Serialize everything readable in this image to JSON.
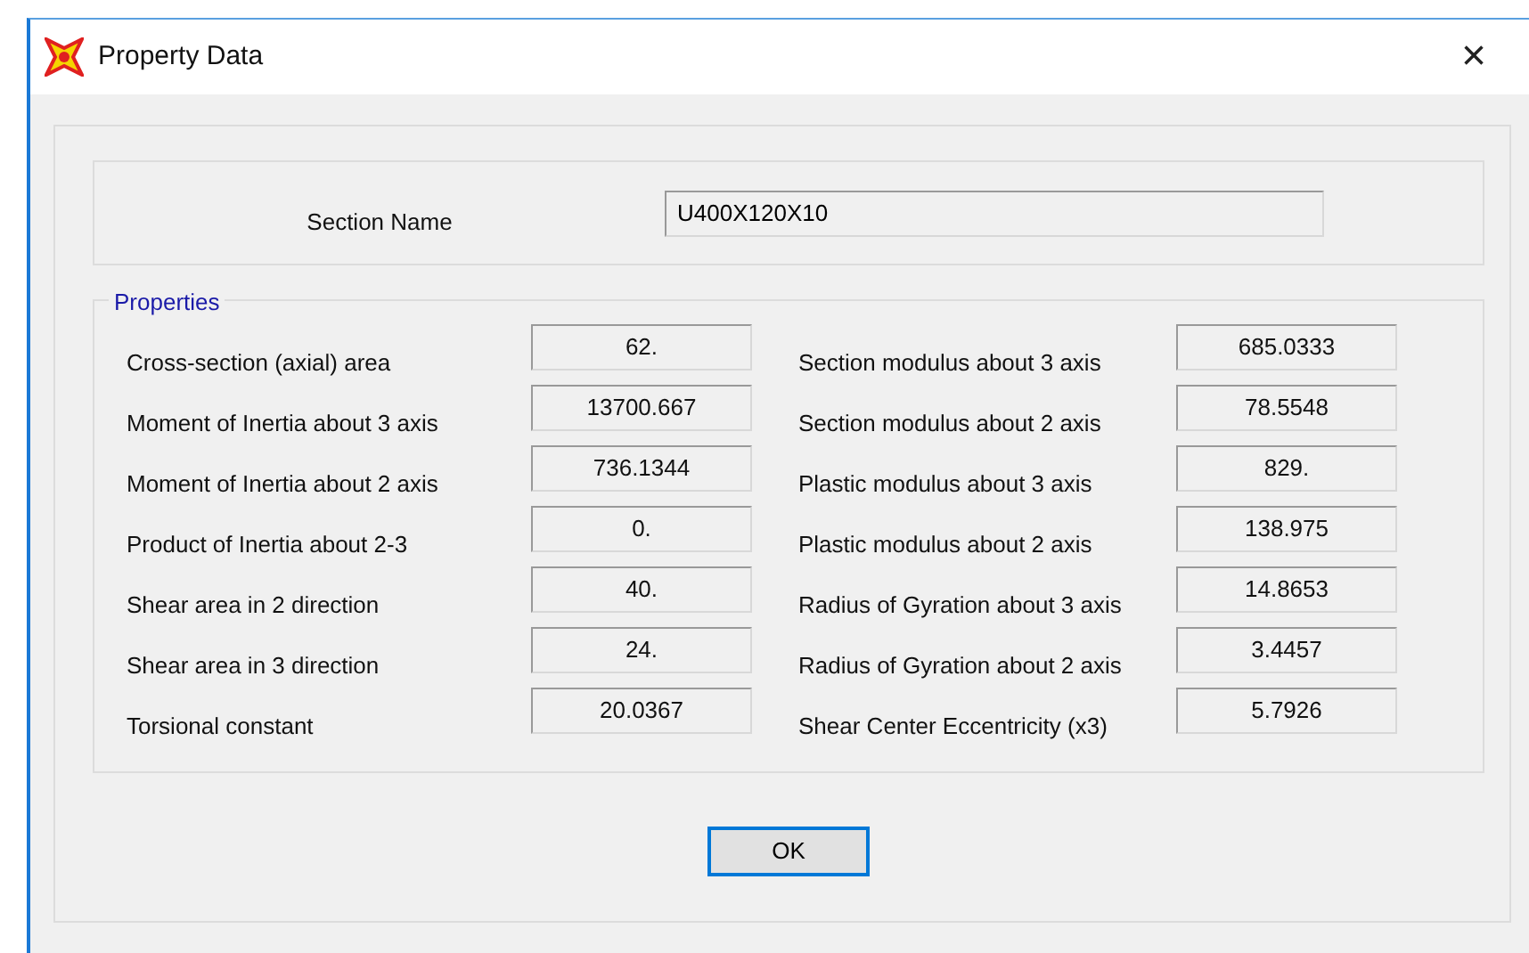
{
  "window": {
    "title": "Property Data",
    "close": "×"
  },
  "section_name": {
    "label": "Section Name",
    "value": "U400X120X10"
  },
  "properties": {
    "title": "Properties",
    "left": [
      {
        "label": "Cross-section (axial) area",
        "value": "62."
      },
      {
        "label": "Moment of Inertia about 3 axis",
        "value": "13700.667"
      },
      {
        "label": "Moment of Inertia about 2 axis",
        "value": "736.1344"
      },
      {
        "label": "Product of Inertia about 2-3",
        "value": "0."
      },
      {
        "label": "Shear area in 2 direction",
        "value": "40."
      },
      {
        "label": "Shear area in 3 direction",
        "value": "24."
      },
      {
        "label": "Torsional constant",
        "value": "20.0367"
      }
    ],
    "right": [
      {
        "label": "Section modulus about 3 axis",
        "value": "685.0333"
      },
      {
        "label": "Section modulus about 2 axis",
        "value": "78.5548"
      },
      {
        "label": "Plastic modulus about 3 axis",
        "value": "829."
      },
      {
        "label": "Plastic modulus about 2 axis",
        "value": "138.975"
      },
      {
        "label": "Radius of Gyration about 3 axis",
        "value": "14.8653"
      },
      {
        "label": "Radius of Gyration about 2 axis",
        "value": "3.4457"
      },
      {
        "label": "Shear Center Eccentricity (x3)",
        "value": "5.7926"
      }
    ]
  },
  "buttons": [
    "OK"
  ]
}
